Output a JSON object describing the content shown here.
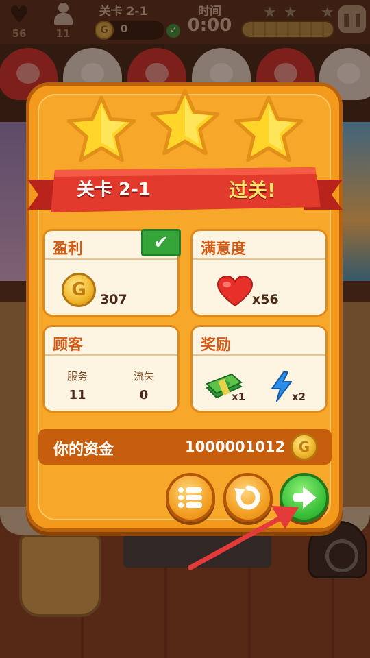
{
  "hud": {
    "lives": "56",
    "customers": "11",
    "level": "关卡 2-1",
    "coins": "0",
    "time_label": "时间",
    "time": "0:00",
    "progress": 1.0,
    "stars_earned": 3,
    "pause_icon": "pause-icon"
  },
  "result": {
    "stars": 3,
    "level_label": "关卡 2-1",
    "status_label": "过关!",
    "profit": {
      "title": "盈利",
      "amount": "307",
      "coin_symbol": "G"
    },
    "satisfaction": {
      "title": "满意度",
      "value": "x56"
    },
    "customers": {
      "title": "顾客",
      "served_label": "服务",
      "served": "11",
      "lost_label": "流失",
      "lost": "0"
    },
    "rewards": {
      "title": "奖励",
      "cash_count": "x1",
      "energy_count": "x2"
    },
    "funds": {
      "label": "你的资金",
      "value": "1000001012",
      "coin_symbol": "G"
    },
    "buttons": {
      "menu_icon": "list-icon",
      "replay_icon": "replay-icon",
      "next_icon": "arrow-right-icon"
    }
  },
  "colors": {
    "panel": "#f39a1c",
    "ribbon": "#e23a2c",
    "card": "#fdf4e2",
    "accent_title": "#d25a14",
    "next_button": "#3cc23a",
    "pointer_arrow": "#e33a3a"
  }
}
